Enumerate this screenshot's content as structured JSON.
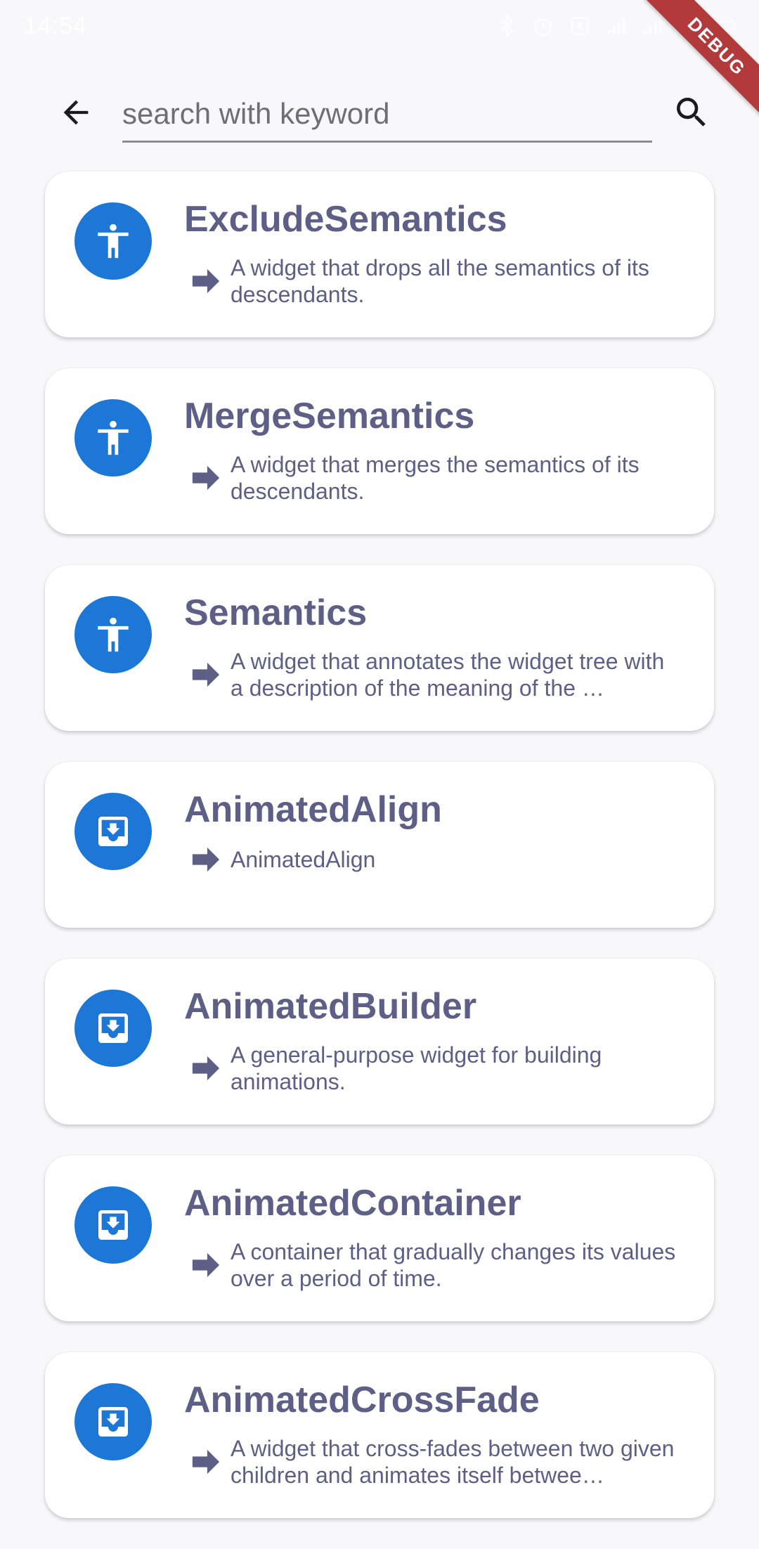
{
  "status_bar": {
    "time": "14:54"
  },
  "debug_label": "DEBUG",
  "search": {
    "placeholder": "search with keyword",
    "value": ""
  },
  "colors": {
    "accent": "#1c77d6",
    "text": "#5e5f86",
    "background": "#f8f8fa",
    "debug": "#b23a3a"
  },
  "items": [
    {
      "title": "ExcludeSemantics",
      "description": "A widget that drops all the semantics of its descendants.",
      "icon": "accessibility-icon"
    },
    {
      "title": "MergeSemantics",
      "description": "A widget that merges the semantics of its descendants.",
      "icon": "accessibility-icon"
    },
    {
      "title": "Semantics",
      "description": "A widget that annotates the widget tree with a description of the meaning of the …",
      "icon": "accessibility-icon"
    },
    {
      "title": "AnimatedAlign",
      "description": "AnimatedAlign",
      "icon": "move-to-inbox-icon"
    },
    {
      "title": "AnimatedBuilder",
      "description": "A general-purpose widget for building animations.",
      "icon": "move-to-inbox-icon"
    },
    {
      "title": "AnimatedContainer",
      "description": "A container that gradually changes its values over a period of time.",
      "icon": "move-to-inbox-icon"
    },
    {
      "title": "AnimatedCrossFade",
      "description": "A widget that cross-fades between two given children and animates itself betwee…",
      "icon": "move-to-inbox-icon"
    }
  ]
}
